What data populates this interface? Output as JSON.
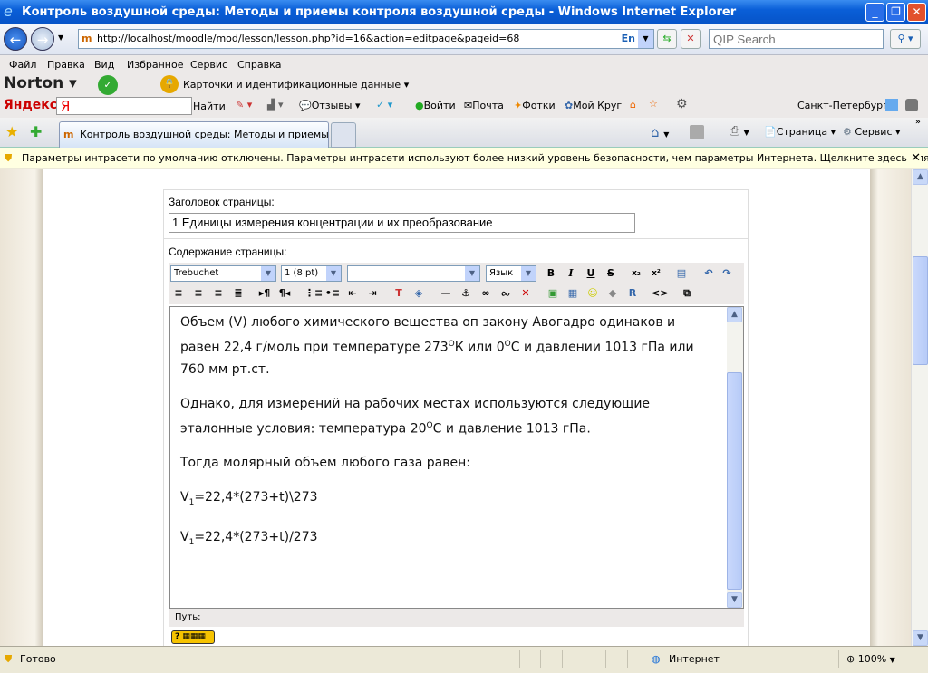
{
  "window": {
    "title": "Контроль воздушной среды: Методы и приемы контроля воздушной среды - Windows Internet Explorer"
  },
  "address": {
    "url": "http://localhost/moodle/mod/lesson/lesson.php?id=16&action=editpage&pageid=68",
    "lang": "En",
    "search_placeholder": "QIP Search"
  },
  "menu": [
    "Файл",
    "Правка",
    "Вид",
    "Избранное",
    "Сервис",
    "Справка"
  ],
  "norton": {
    "brand": "Norton",
    "cards": "Карточки и идентификационные данные"
  },
  "yandex": {
    "brand": "Яндекс",
    "logo": "Я",
    "find": "Найти",
    "reviews": "Отзывы",
    "login": "Войти",
    "mail": "Почта",
    "photos": "Фотки",
    "circle": "Мой Круг",
    "city": "Санкт-Петербург"
  },
  "tabs": {
    "active": "Контроль воздушной среды: Методы и приемы ко...",
    "page": "Страница",
    "service": "Сервис"
  },
  "infobar": {
    "text": "Параметры интрасети по умолчанию отключены. Параметры интрасети используют более низкий уровень безопасности, чем параметры Интернета. Щелкните здесь для настройки..."
  },
  "form": {
    "title_label": "Заголовок страницы:",
    "title_value": "1 Единицы измерения концентрации и их преобразование",
    "content_label": "Содержание страницы:",
    "font": "Trebuchet",
    "size": "1 (8 pt)",
    "format": "",
    "lang": "Язык",
    "path_label": "Путь:"
  },
  "editor": {
    "p1a": "Объем (V) любого химического вещества оп закону Авогадро одинаков и равен 22,4 г/моль при температуре 273",
    "sup_o": "O",
    "p1b": "К или 0",
    "p1c": "С и давлении 1013 гПа или 760 мм рт.ст.",
    "p2a": "Однако, для измерений на рабочих местах используются следующие эталонные условия: температура 20",
    "p2b": "С и давление 1013 гПа.",
    "p3": "Тогда молярный объем любого газа равен:",
    "v": "V",
    "sub1": "1",
    "f1": "=22,4*(273+t)\\273",
    "f2": "=22,4*(273+t)/273"
  },
  "status": {
    "ready": "Готово",
    "zone": "Интернет",
    "zoom": "100%"
  }
}
